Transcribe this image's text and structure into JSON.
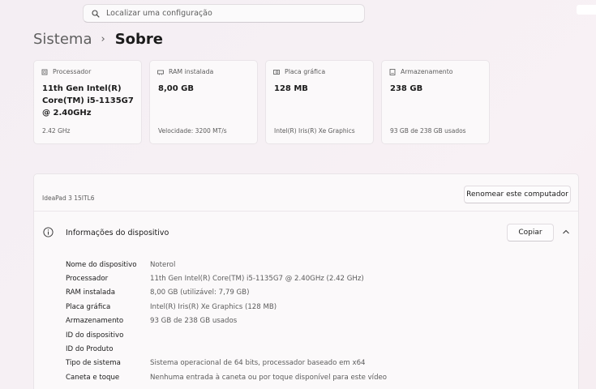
{
  "search": {
    "placeholder": "Localizar uma configuração"
  },
  "breadcrumb": {
    "parent": "Sistema",
    "separator": "›",
    "current": "Sobre"
  },
  "cards": [
    {
      "icon": "processor-icon",
      "label": "Processador",
      "value": "11th Gen Intel(R) Core(TM) i5-1135G7 @ 2.40GHz",
      "sub": "2.42 GHz"
    },
    {
      "icon": "ram-icon",
      "label": "RAM instalada",
      "value": "8,00 GB",
      "sub": "Velocidade: 3200 MT/s"
    },
    {
      "icon": "gpu-icon",
      "label": "Placa gráfica",
      "value": "128 MB",
      "sub": "Intel(R) Iris(R) Xe Graphics"
    },
    {
      "icon": "storage-icon",
      "label": "Armazenamento",
      "value": "238 GB",
      "sub": "93 GB de 238 GB usados"
    }
  ],
  "device": {
    "model": "IdeaPad 3 15ITL6",
    "rename_label": "Renomear este computador",
    "info_title": "Informações do dispositivo",
    "copy_label": "Copiar",
    "specs": [
      {
        "key": "Nome do dispositivo",
        "value": "Noterol"
      },
      {
        "key": "Processador",
        "value": "11th Gen Intel(R) Core(TM) i5-1135G7 @ 2.40GHz (2.42 GHz)"
      },
      {
        "key": "RAM instalada",
        "value": "8,00 GB (utilizável: 7,79 GB)"
      },
      {
        "key": "Placa gráfica",
        "value": "Intel(R) Iris(R) Xe Graphics (128 MB)"
      },
      {
        "key": "Armazenamento",
        "value": "93 GB de 238 GB usados"
      },
      {
        "key": "ID do dispositivo",
        "value": ""
      },
      {
        "key": "ID do Produto",
        "value": ""
      },
      {
        "key": "Tipo de sistema",
        "value": "Sistema operacional de 64 bits, processador baseado em x64"
      },
      {
        "key": "Caneta e toque",
        "value": "Nenhuma entrada à caneta ou por toque disponível para este vídeo"
      }
    ]
  },
  "colors": {
    "background": "#f6f0f4",
    "card": "#fbf9fa",
    "border": "#e9e4e8"
  }
}
